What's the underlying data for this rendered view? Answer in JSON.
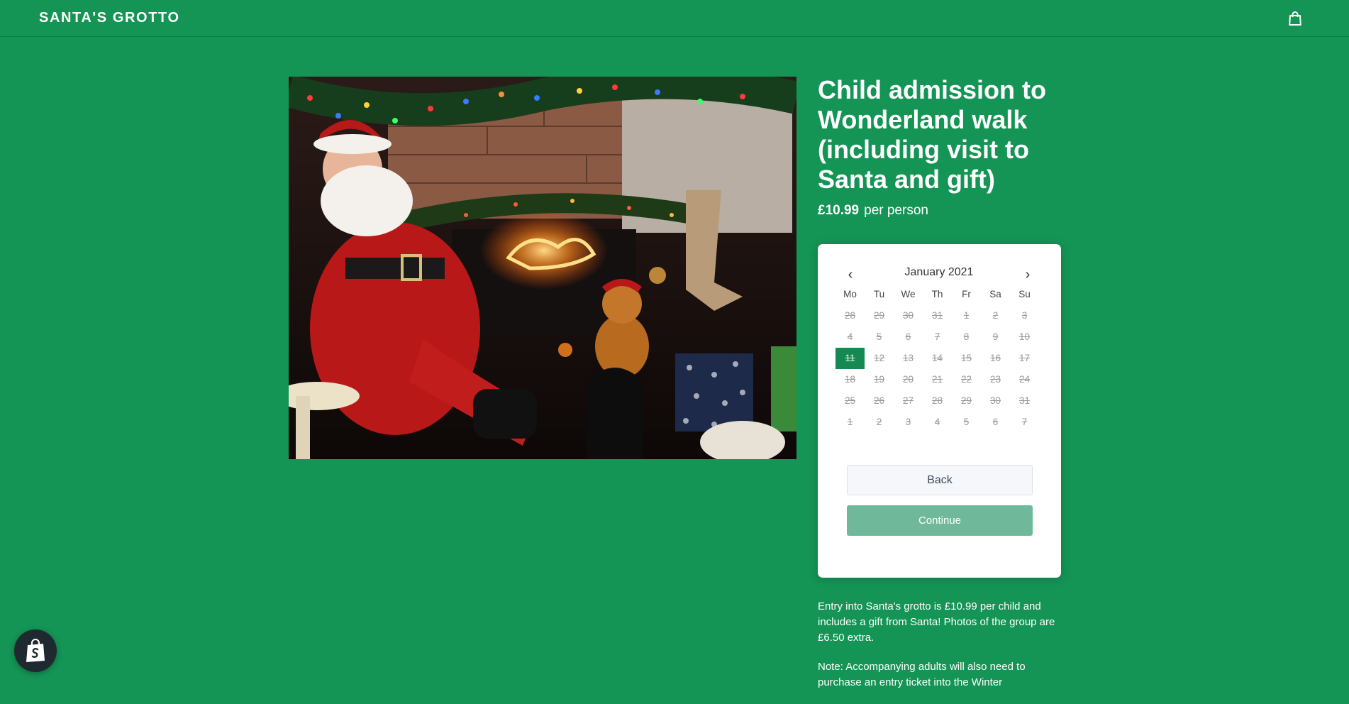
{
  "header": {
    "logo": "SANTA'S GROTTO",
    "cart_icon": "shopping-bag-icon"
  },
  "product": {
    "image_alt": "Santa sitting in his grotto with Christmas lights and a teddy bear",
    "title": "Child admission to Wonderland walk (including visit to Santa and gift)",
    "price": "£10.99",
    "price_unit": "per person"
  },
  "calendar": {
    "prev": "‹",
    "next": "›",
    "month": "January 2021",
    "weekdays": [
      "Mo",
      "Tu",
      "We",
      "Th",
      "Fr",
      "Sa",
      "Su"
    ],
    "days": [
      "28",
      "29",
      "30",
      "31",
      "1",
      "2",
      "3",
      "4",
      "5",
      "6",
      "7",
      "8",
      "9",
      "10",
      "11",
      "12",
      "13",
      "14",
      "15",
      "16",
      "17",
      "18",
      "19",
      "20",
      "21",
      "22",
      "23",
      "24",
      "25",
      "26",
      "27",
      "28",
      "29",
      "30",
      "31",
      "1",
      "2",
      "3",
      "4",
      "5",
      "6",
      "7"
    ],
    "selected_index": 14,
    "back_label": "Back",
    "continue_label": "Continue"
  },
  "description": {
    "p1": "Entry into Santa's grotto is £10.99 per child and includes a gift from Santa! Photos of the group are £6.50 extra.",
    "p2": "Note: Accompanying adults will also need to purchase an entry ticket into the Winter"
  },
  "badge": {
    "icon": "shopify-bag-icon"
  },
  "colors": {
    "background": "#149455",
    "selected_day": "#148a52",
    "continue_button": "#6fb99a"
  }
}
